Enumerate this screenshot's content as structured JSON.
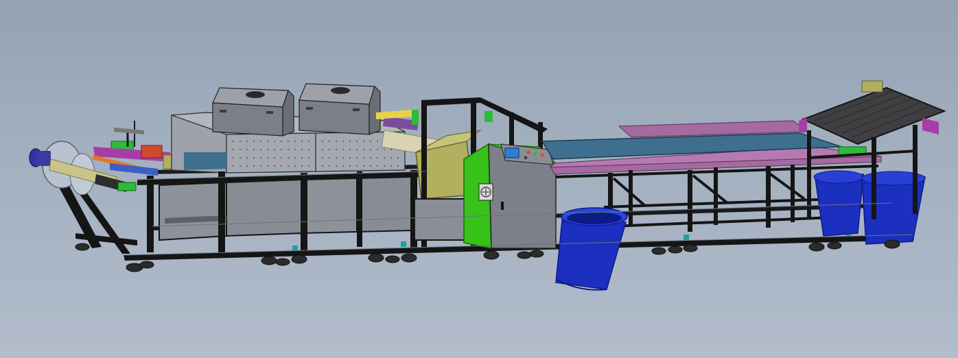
{
  "view": {
    "background_top": "#94a2b4",
    "background_bottom": "#b2bccb"
  },
  "colors": {
    "frame": "#151515",
    "frame_edge": "#6d7480",
    "panel": "#8d929a",
    "panel_dark": "#6f747c",
    "hood": "#9a9ca3",
    "cover": "#7c7f88",
    "belt_blue": "#3e6f8f",
    "belt_dark": "#3f3f42",
    "pink": "#a56aa0",
    "cabinet_green": "#36c218",
    "cabinet_gray": "#7d8088",
    "screen": "#2f7fd8",
    "olive": "#b2b05e",
    "roller": "#c9c48a",
    "motor": "#3530a8",
    "bucket": "#1b2fc0",
    "bucket_dark": "#0d1b86",
    "accent_green": "#2dbb3a",
    "accent_red": "#d24a2e",
    "accent_purple": "#a83ca6",
    "accent_orange": "#e07a2a",
    "teal": "#1aa39a",
    "caster": "#2b2b2b"
  },
  "components": [
    {
      "id": "unwind-roll",
      "icon": "spool-icon"
    },
    {
      "id": "feed-unit",
      "icon": "rollers-icon"
    },
    {
      "id": "coating-hood-1",
      "icon": "hood-icon"
    },
    {
      "id": "coating-hood-2",
      "icon": "hood-icon"
    },
    {
      "id": "press-unit",
      "icon": "press-icon"
    },
    {
      "id": "control-cabinet",
      "icon": "control-panel-icon"
    },
    {
      "id": "conveyor-blue",
      "icon": "conveyor-icon"
    },
    {
      "id": "conveyor-pink",
      "icon": "conveyor-icon"
    },
    {
      "id": "outfeed-conveyor",
      "icon": "conveyor-icon"
    },
    {
      "id": "bucket-front",
      "icon": "bucket-icon"
    },
    {
      "id": "bucket-rear",
      "icon": "bucket-icon"
    }
  ]
}
